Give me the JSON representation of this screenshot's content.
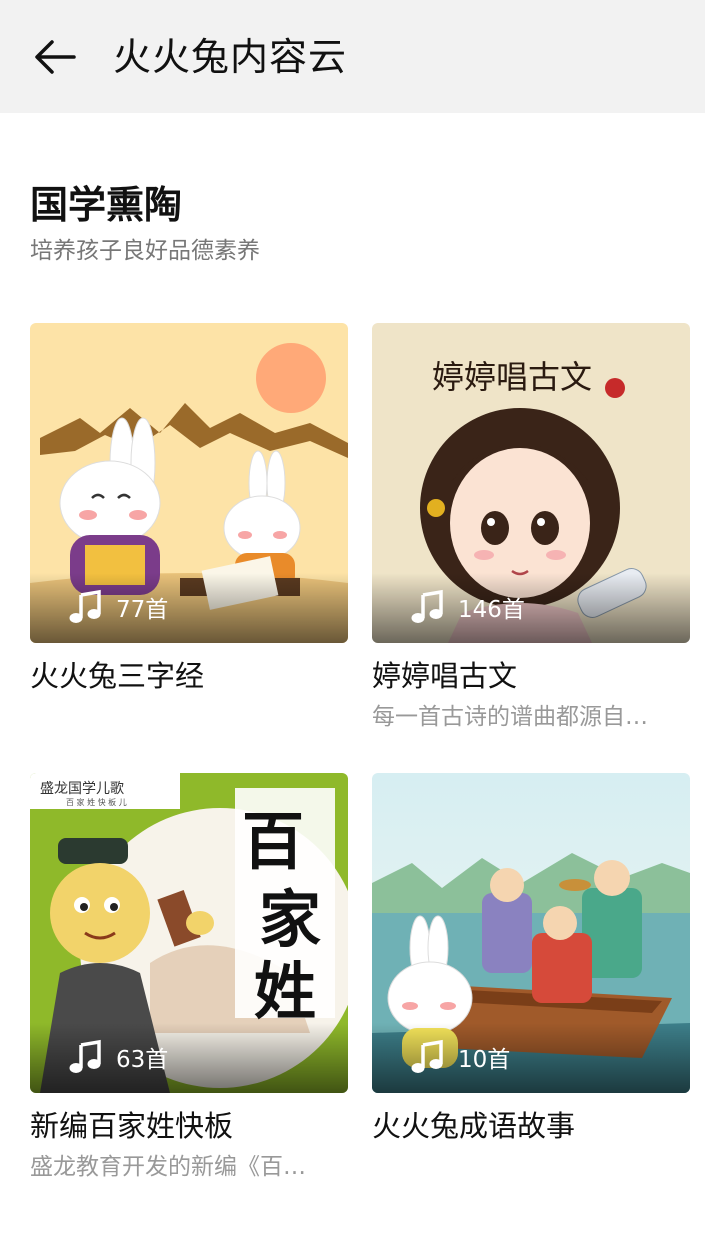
{
  "header": {
    "title": "火火兔内容云"
  },
  "section": {
    "title": "国学熏陶",
    "subtitle": "培养孩子良好品德素养"
  },
  "cards": [
    {
      "name": "火火兔三字经",
      "count": "77首",
      "desc": ""
    },
    {
      "name": "婷婷唱古文",
      "count": "146首",
      "desc": "每一首古诗的谱曲都源自…",
      "cover_title": "婷婷唱古文"
    },
    {
      "name": "新编百家姓快板",
      "count": "63首",
      "desc": " 盛龙教育开发的新编《百…",
      "cover_title": "百家姓",
      "cover_tag": "盛龙国学儿歌",
      "cover_tag_sub": "百 家 姓   快 板 儿"
    },
    {
      "name": "火火兔成语故事",
      "count": "10首",
      "desc": ""
    }
  ],
  "colors": {
    "appbar": "#f2f2f2",
    "subtitle": "#777777",
    "desc": "#999999"
  }
}
